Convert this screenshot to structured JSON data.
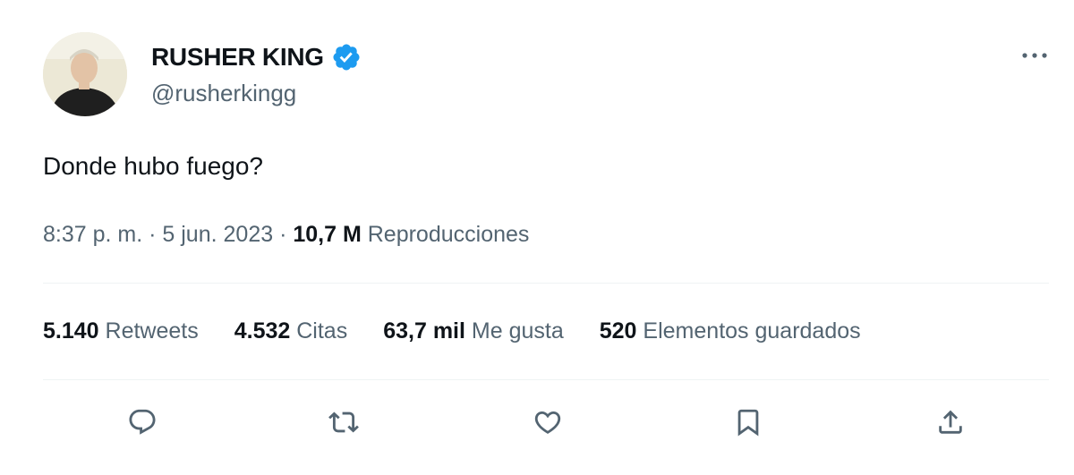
{
  "author": {
    "display_name": "RUSHER KING",
    "handle": "@rusherkingg",
    "verified": true
  },
  "tweet": {
    "text": "Donde hubo fuego?",
    "time": "8:37 p. m.",
    "separator": "·",
    "date": "5 jun. 2023",
    "views_count": "10,7 M",
    "views_label": "Reproducciones"
  },
  "stats": {
    "retweets": {
      "count": "5.140",
      "label": "Retweets"
    },
    "quotes": {
      "count": "4.532",
      "label": "Citas"
    },
    "likes": {
      "count": "63,7 mil",
      "label": "Me gusta"
    },
    "bookmarks": {
      "count": "520",
      "label": "Elementos guardados"
    }
  },
  "icons": {
    "more": "more-horizontal-icon",
    "verified": "verified-badge-icon",
    "reply": "reply-icon",
    "retweet": "retweet-icon",
    "like": "heart-icon",
    "bookmark": "bookmark-icon",
    "share": "share-icon"
  },
  "colors": {
    "verified_blue": "#1d9bf0",
    "text_primary": "#0f1419",
    "text_secondary": "#536471",
    "divider": "#eff3f4"
  }
}
